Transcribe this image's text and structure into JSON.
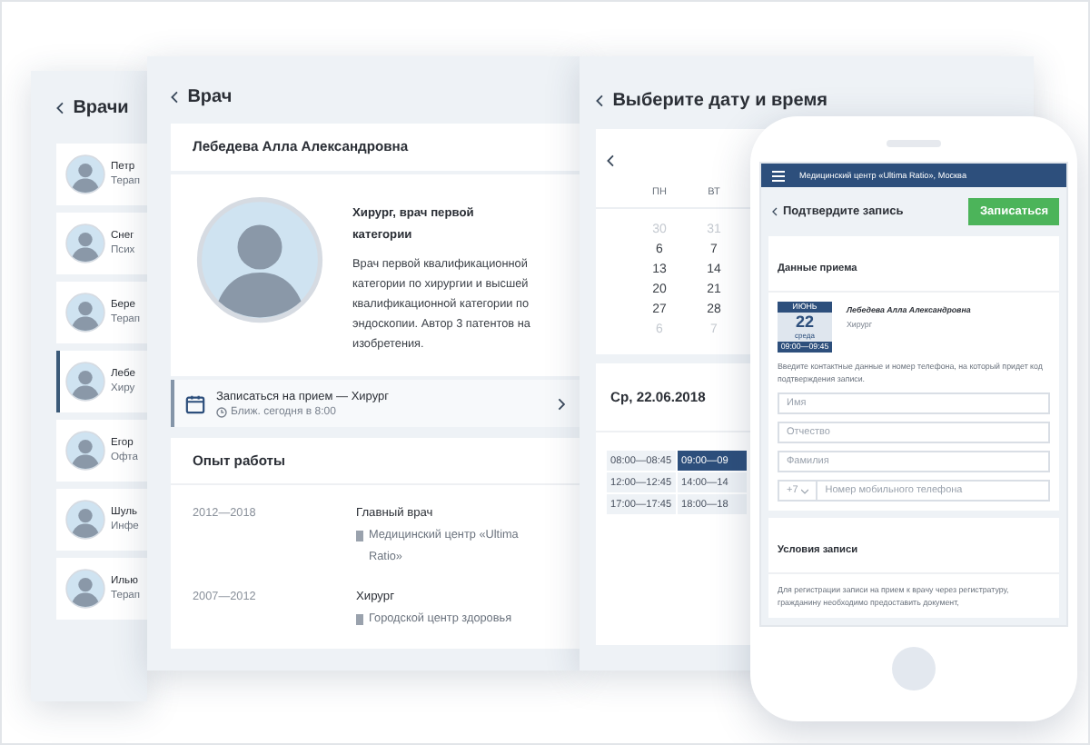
{
  "doctors_panel": {
    "title": "Врачи",
    "items": [
      {
        "name": "Петр",
        "specialty": "Терап",
        "selected": false
      },
      {
        "name": "Снег",
        "specialty": "Псих",
        "selected": false
      },
      {
        "name": "Бере",
        "specialty": "Терап",
        "selected": false
      },
      {
        "name": "Лебе",
        "specialty": "Хиру",
        "selected": true
      },
      {
        "name": "Егор",
        "specialty": "Офта",
        "selected": false
      },
      {
        "name": "Шуль",
        "specialty": "Инфе",
        "selected": false
      },
      {
        "name": "Илью",
        "specialty": "Терап",
        "selected": false
      }
    ]
  },
  "doctor_panel": {
    "title": "Врач",
    "name": "Лебедева Алла Александровна",
    "headline": "Хирург, врач первой категории",
    "bio": "Врач первой квалификационной категории по хирургии и высшей квалификационной категории по эндоскопии. Автор 3 патентов на изобретения.",
    "appointment": {
      "title": "Записаться на прием — Хирург",
      "next": "Ближ. сегодня в 8:00"
    },
    "experience": {
      "title": "Опыт работы",
      "items": [
        {
          "period": "2012—2018",
          "position": "Главный врач",
          "place": "Медицинский центр «Ultima Ratio»"
        },
        {
          "period": "2007—2012",
          "position": "Хирург",
          "place": "Городской центр здоровья"
        }
      ]
    }
  },
  "schedule_panel": {
    "title": "Выберите дату и время",
    "weekdays": [
      "ПН",
      "ВТ"
    ],
    "weeks": [
      [
        {
          "day": "30",
          "muted": true
        },
        {
          "day": "31",
          "muted": true
        }
      ],
      [
        {
          "day": "6",
          "muted": false
        },
        {
          "day": "7",
          "muted": false
        }
      ],
      [
        {
          "day": "13",
          "muted": false
        },
        {
          "day": "14",
          "muted": false
        }
      ],
      [
        {
          "day": "20",
          "muted": false
        },
        {
          "day": "21",
          "muted": false
        }
      ],
      [
        {
          "day": "27",
          "muted": false
        },
        {
          "day": "28",
          "muted": false
        }
      ],
      [
        {
          "day": "6",
          "muted": true
        },
        {
          "day": "7",
          "muted": true
        }
      ]
    ],
    "date": "Ср, 22.06.2018",
    "slots": [
      {
        "time": "08:00—08:45",
        "selected": false
      },
      {
        "time": "09:00—09",
        "selected": true
      },
      {
        "time": "12:00—12:45",
        "selected": false
      },
      {
        "time": "14:00—14",
        "selected": false
      },
      {
        "time": "17:00—17:45",
        "selected": false
      },
      {
        "time": "18:00—18",
        "selected": false
      }
    ]
  },
  "phone": {
    "header": "Медицинский центр «Ultima Ratio», Москва",
    "title": "Подтвердите запись",
    "submit": "Записаться",
    "details": {
      "title": "Данные приема",
      "month": "ИЮНЬ",
      "day": "22",
      "weekday": "среда",
      "time": "09:00—09:45",
      "doctor": "Лебедева Алла Александровна",
      "specialty": "Хирург",
      "hint": "Введите контактные данные и номер телефона, на который придет код подтверждения записи.",
      "fields": [
        {
          "placeholder": "Имя"
        },
        {
          "placeholder": "Отчество"
        },
        {
          "placeholder": "Фамилия"
        }
      ],
      "phone_code": "+7",
      "phone_placeholder": "Номер мобильного телефона"
    },
    "terms": {
      "title": "Условия записи",
      "text": "Для регистрации записи на прием к врачу через регистратуру, гражданину необходимо предоставить документ,"
    }
  }
}
